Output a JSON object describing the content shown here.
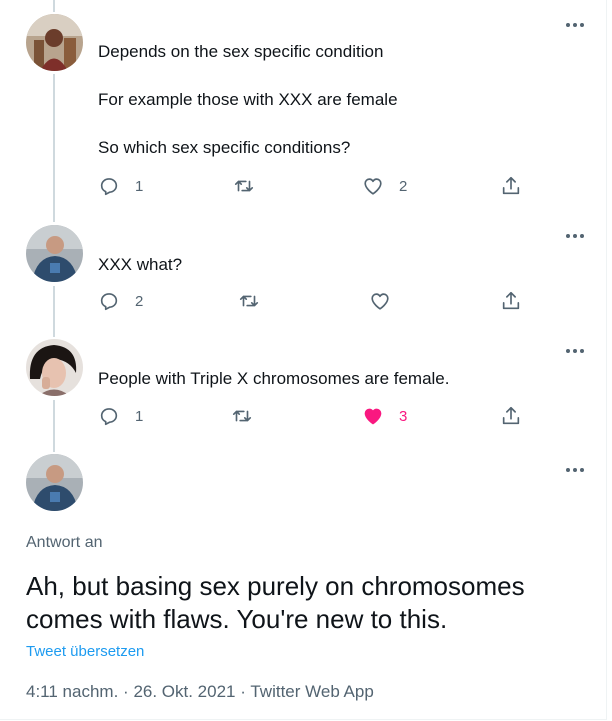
{
  "tweets": [
    {
      "lines": [
        "Depends on the sex specific condition",
        "For example those  with XXX are female",
        "So which sex specific conditions?"
      ],
      "actions": {
        "reply_count": "1",
        "retweet_count": "",
        "like_count": "2",
        "liked": false
      }
    },
    {
      "lines": [
        "XXX what?"
      ],
      "actions": {
        "reply_count": "2",
        "retweet_count": "",
        "like_count": "",
        "liked": false
      }
    },
    {
      "lines": [
        "People with Triple X chromosomes are female."
      ],
      "actions": {
        "reply_count": "1",
        "retweet_count": "",
        "like_count": "3",
        "liked": true
      }
    }
  ],
  "main_tweet": {
    "reply_label": "Antwort an",
    "text": "Ah, but basing sex purely on chromosomes comes with flaws. You're new to this.",
    "translate_label": "Tweet übersetzen",
    "time": "4:11 nachm.",
    "date": "26. Okt. 2021",
    "source": "Twitter Web App",
    "separator": "·"
  },
  "colors": {
    "like_active": "#f91880",
    "link": "#1d9bf0",
    "secondary_text": "#536471",
    "thread_line": "#cfd9de"
  },
  "icons": [
    "reply-icon",
    "retweet-icon",
    "like-icon",
    "share-icon",
    "more-icon"
  ]
}
